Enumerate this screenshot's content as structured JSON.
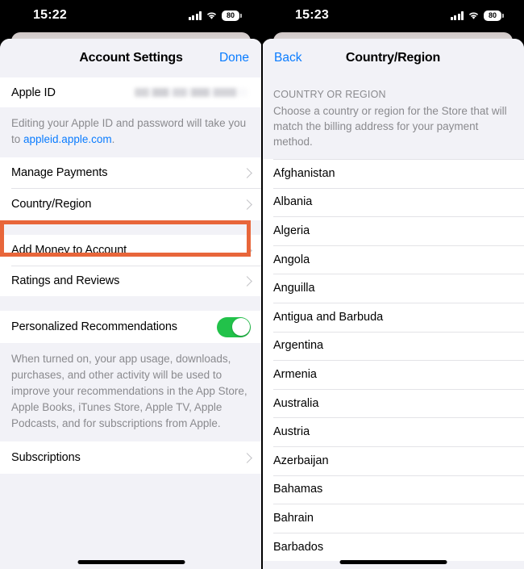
{
  "left": {
    "statusbar": {
      "time": "15:22",
      "battery": "80",
      "signal_icon": "cellular-bars-icon",
      "wifi_icon": "wifi-icon",
      "battery_icon": "battery-icon"
    },
    "nav": {
      "title": "Account Settings",
      "right_button": "Done"
    },
    "rows": {
      "apple_id": {
        "label": "Apple ID",
        "value": "",
        "value_redacted": true
      },
      "manage_payments": "Manage Payments",
      "country_region": "Country/Region",
      "add_money": "Add Money to Account",
      "ratings_reviews": "Ratings and Reviews",
      "personalized": "Personalized Recommendations",
      "subscriptions": "Subscriptions"
    },
    "apple_id_footer_pre": "Editing your Apple ID and password will take you to ",
    "apple_id_footer_link": "appleid.apple.com",
    "apple_id_footer_post": ".",
    "personalized_footer": "When turned on, your app usage, downloads, purchases, and other activity will be used to improve your recommendations in the App Store, Apple Books, iTunes Store, Apple TV, Apple Podcasts, and for subscriptions from Apple.",
    "toggle_on": true,
    "highlight_color": "#e8663a",
    "accent_color": "#0a7cff",
    "toggle_color": "#22c24a"
  },
  "right": {
    "statusbar": {
      "time": "15:23",
      "battery": "80",
      "signal_icon": "cellular-bars-icon",
      "wifi_icon": "wifi-icon",
      "battery_icon": "battery-icon"
    },
    "nav": {
      "left_button": "Back",
      "title": "Country/Region"
    },
    "section_header": "COUNTRY OR REGION",
    "section_description": "Choose a country or region for the Store that will match the billing address for your payment method.",
    "countries": [
      "Afghanistan",
      "Albania",
      "Algeria",
      "Angola",
      "Anguilla",
      "Antigua and Barbuda",
      "Argentina",
      "Armenia",
      "Australia",
      "Austria",
      "Azerbaijan",
      "Bahamas",
      "Bahrain",
      "Barbados"
    ]
  }
}
